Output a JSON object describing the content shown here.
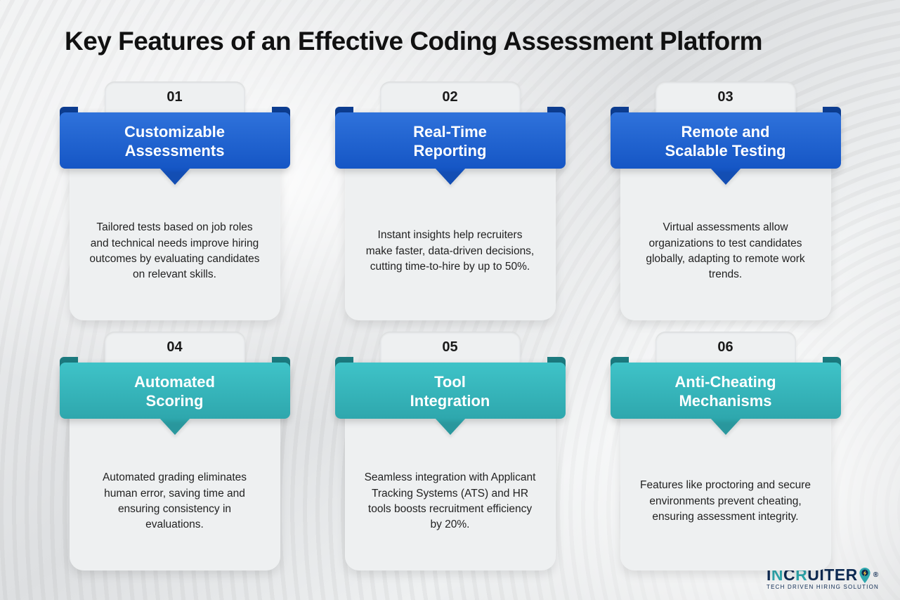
{
  "title": "Key Features of an Effective Coding Assessment Platform",
  "colors": {
    "blue_primary": "#1e5ecf",
    "blue_dark": "#0d3d90",
    "teal_primary": "#31b6bb",
    "teal_dark": "#1c7a7f",
    "panel_bg": "#eef0f1",
    "text": "#1a1a1a"
  },
  "features": [
    {
      "number": "01",
      "heading_l1": "Customizable",
      "heading_l2": "Assessments",
      "description": "Tailored tests based on job roles and technical needs improve hiring outcomes by evaluating candidates on relevant skills.",
      "theme": "blue"
    },
    {
      "number": "02",
      "heading_l1": "Real-Time",
      "heading_l2": "Reporting",
      "description": "Instant insights help recruiters make faster, data-driven decisions, cutting time-to-hire by up to 50%.",
      "theme": "blue"
    },
    {
      "number": "03",
      "heading_l1": "Remote and",
      "heading_l2": "Scalable Testing",
      "description": "Virtual assessments allow organizations to test candidates globally, adapting to remote work trends.",
      "theme": "blue"
    },
    {
      "number": "04",
      "heading_l1": "Automated",
      "heading_l2": "Scoring",
      "description": "Automated grading eliminates human error, saving time and ensuring consistency in evaluations.",
      "theme": "teal"
    },
    {
      "number": "05",
      "heading_l1": "Tool",
      "heading_l2": "Integration",
      "description": "Seamless integration with Applicant Tracking Systems (ATS) and HR tools boosts recruitment efficiency by 20%.",
      "theme": "teal"
    },
    {
      "number": "06",
      "heading_l1": "Anti-Cheating",
      "heading_l2": "Mechanisms",
      "description": "Features like proctoring and secure environments prevent cheating, ensuring assessment integrity.",
      "theme": "teal"
    }
  ],
  "logo": {
    "pre": "I",
    "n": "N",
    "c": "C",
    "r": "R",
    "suffix": "UITER",
    "reg": "®",
    "tagline": "TECH DRIVEN HIRING SOLUTION",
    "icon_name": "map-pin-bolt-icon"
  }
}
